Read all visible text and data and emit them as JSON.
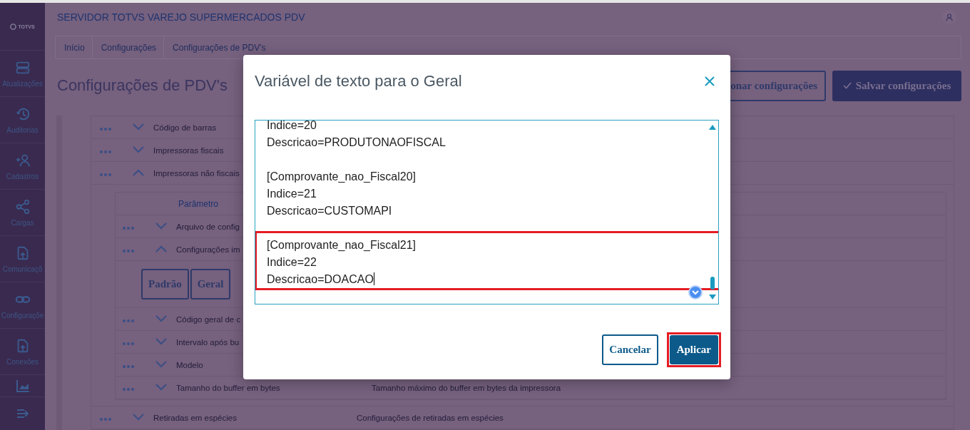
{
  "logo": "TOTVS",
  "sidebar": {
    "items": [
      {
        "label": "Atualizações"
      },
      {
        "label": "Auditorias"
      },
      {
        "label": "Cadastros"
      },
      {
        "label": "Cargas"
      },
      {
        "label": "Comunicaçõ"
      },
      {
        "label": "Configuraçõe"
      },
      {
        "label": "Conexões"
      }
    ]
  },
  "header": {
    "title": "SERVIDOR TOTVS VAREJO SUPERMERCADOS PDV"
  },
  "breadcrumb": [
    "Início",
    "Configurações",
    "Configurações de PDV's"
  ],
  "page_title": "Configurações de PDV's",
  "page_buttons": [
    {
      "label": "onar configurações",
      "kind": "secondary"
    },
    {
      "label": "Salvar configurações",
      "kind": "primary"
    }
  ],
  "tree": [
    {
      "label": "Código de barras",
      "expanded": false
    },
    {
      "label": "Impressoras fiscais",
      "expanded": false
    },
    {
      "label": "Impressoras não fiscais",
      "expanded": true,
      "columns": [
        "Parâmetro"
      ],
      "children": [
        {
          "label": "Arquivo de config",
          "expanded": false
        },
        {
          "label": "Configurações im",
          "expanded": true,
          "buttons": [
            "Padrão",
            "Geral"
          ]
        },
        {
          "label": "Código geral de c",
          "expanded": false
        },
        {
          "label": "Intervalo após bu",
          "expanded": false
        },
        {
          "label": "Modelo",
          "expanded": false
        },
        {
          "label": "Tamanho do buffer em bytes",
          "description": "Tamanho máximo do buffer em bytes da impressora",
          "expanded": false
        }
      ]
    },
    {
      "label": "Retiradas em espécies",
      "description": "Configurações de retiradas em espécies",
      "expanded": false
    }
  ],
  "dialog": {
    "title": "Variável de texto para o Geral",
    "text_blocks": [
      {
        "lines": [
          "Indice=20",
          "Descricao=PRODUTONAOFISCAL"
        ],
        "highlighted": false
      },
      {
        "lines": [
          "[Comprovante_nao_Fiscal20]",
          "Indice=21",
          "Descricao=CUSTOMAPI"
        ],
        "highlighted": false
      },
      {
        "lines": [
          "[Comprovante_nao_Fiscal21]",
          "Indice=22",
          "Descricao=DOACAO"
        ],
        "highlighted": true
      }
    ],
    "buttons": [
      {
        "label": "Cancelar",
        "kind": "secondary",
        "highlighted": false
      },
      {
        "label": "Aplicar",
        "kind": "primary",
        "highlighted": true
      }
    ]
  }
}
